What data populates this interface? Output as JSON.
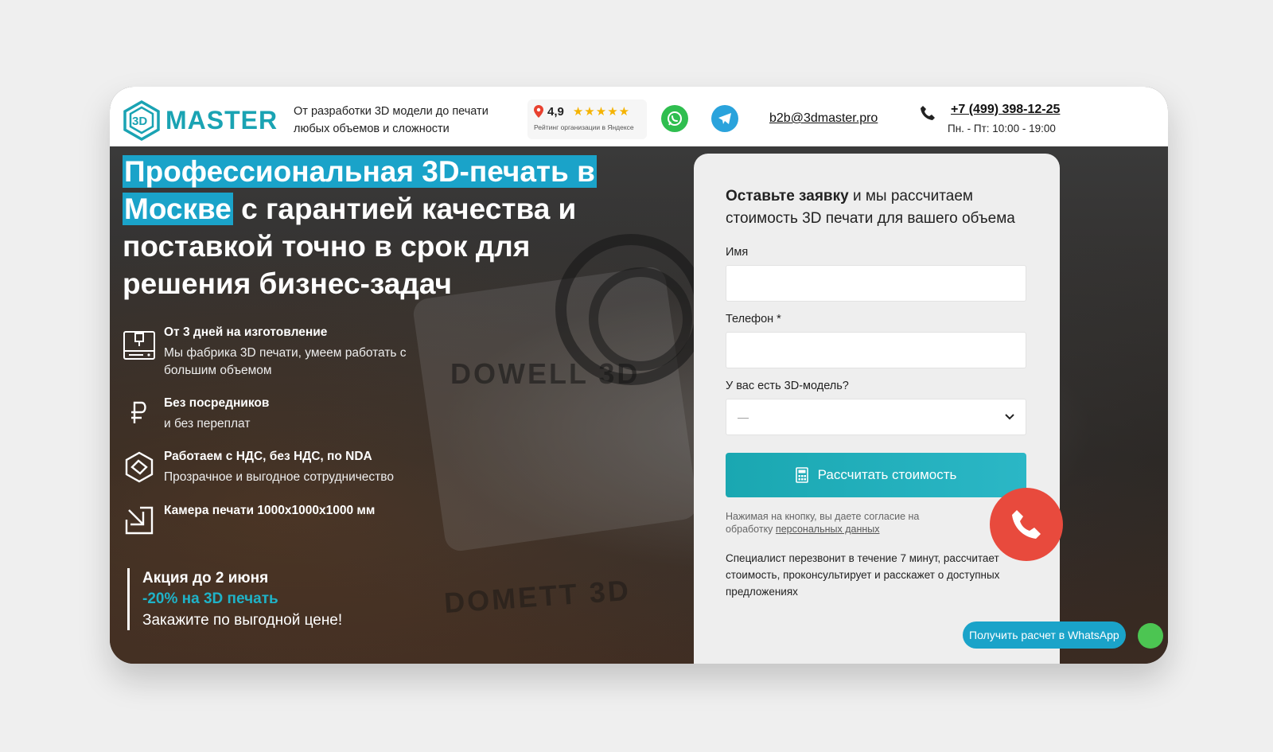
{
  "header": {
    "logo_text": "MASTER",
    "tagline_line1": "От разработки 3D модели до печати",
    "tagline_line2": "любых объемов и сложности",
    "rating_value": "4,9",
    "rating_stars": "★★★★★",
    "rating_caption": "Рейтинг организации в Яндексе",
    "email": "b2b@3dmaster.pro",
    "phone": "+7 (499) 398-12-25",
    "hours": "Пн. - Пт: 10:00 - 19:00"
  },
  "hero": {
    "headline_hl1": "Профессиональная 3D-печать в",
    "headline_hl2": "Москве",
    "headline_rest": " с гарантией качества и поставкой точно в срок для решения бизнес-задач",
    "features": [
      {
        "title": "От 3 дней на изготовление",
        "desc": "Мы фабрика 3D печати, умеем работать с большим объемом",
        "icon": "printer-icon"
      },
      {
        "title": "Без посредников",
        "desc": "и без переплат",
        "icon": "ruble-icon"
      },
      {
        "title": "Работаем с НДС, без НДС, по NDA",
        "desc": "Прозрачное и выгодное сотрудничество",
        "icon": "handshake-icon"
      },
      {
        "title": "Камера печати 1000х1000х1000 мм",
        "desc": "",
        "icon": "resize-icon"
      }
    ],
    "promo": {
      "title": "Акция до 2 июня",
      "discount": "-20% на 3D печать",
      "cta": "Закажите по выгодной цене!"
    },
    "background_text_1": "DOWELL 3D",
    "background_text_2": "DOMETT 3D"
  },
  "form": {
    "heading_bold": "Оставьте заявку",
    "heading_rest": " и мы рассчитаем стоимость 3D печати для вашего объема",
    "name_label": "Имя",
    "name_value": "",
    "phone_label": "Телефон *",
    "phone_value": "",
    "model_label": "У вас есть 3D-модель?",
    "model_selected": "—",
    "submit_label": "Рассчитать стоимость",
    "consent_text": "Нажимая на кнопку, вы даете согласие на обработку ",
    "consent_link": "персональных данных",
    "note": "Специалист перезвонит в течение 7 минут, рассчитает стоимость, проконсультирует и расскажет о доступных предложениях"
  },
  "widgets": {
    "whatsapp_pill": "Получить расчет в WhatsApp"
  },
  "colors": {
    "accent": "#1aa3c9",
    "button": "#1aa7b1",
    "call": "#e84a3d",
    "whatsapp": "#2fbe4f",
    "telegram": "#2aa3dc"
  }
}
